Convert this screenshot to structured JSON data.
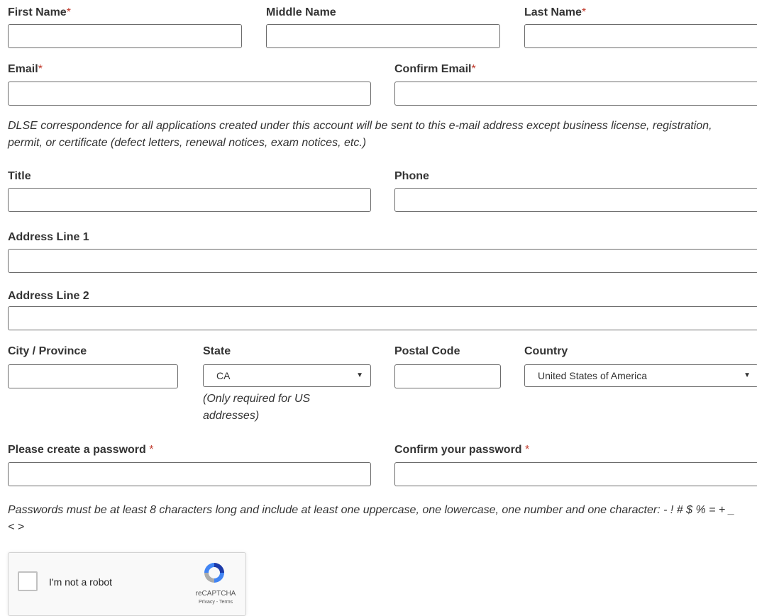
{
  "required_marker": "*",
  "fields": {
    "first_name": {
      "label": "First Name",
      "value": ""
    },
    "middle_name": {
      "label": "Middle Name",
      "value": ""
    },
    "last_name": {
      "label": "Last Name",
      "value": ""
    },
    "email": {
      "label": "Email",
      "value": ""
    },
    "confirm_email": {
      "label": "Confirm Email",
      "value": ""
    },
    "title": {
      "label": "Title",
      "value": ""
    },
    "phone": {
      "label": "Phone",
      "value": ""
    },
    "address1": {
      "label": "Address Line 1",
      "value": ""
    },
    "address2": {
      "label": "Address Line 2",
      "value": ""
    },
    "city": {
      "label": "City / Province",
      "value": ""
    },
    "state": {
      "label": "State",
      "selected": "CA",
      "note": "(Only required for US addresses)"
    },
    "postal_code": {
      "label": "Postal Code",
      "value": ""
    },
    "country": {
      "label": "Country",
      "selected": "United States of America"
    },
    "password": {
      "label": "Please create a password",
      "value": ""
    },
    "confirm_password": {
      "label": "Confirm your password",
      "value": ""
    }
  },
  "notes": {
    "email_note": "DLSE correspondence for all applications created under this account will be sent to this e-mail address except business license, registration, permit, or certificate (defect letters, renewal notices, exam notices, etc.)",
    "password_note": "Passwords must be at least 8 characters long and include at least one uppercase, one lowercase, one number and one character: - ! # $ % = + _ < >"
  },
  "captcha": {
    "label": "I'm not a robot",
    "brand": "reCAPTCHA",
    "links": "Privacy - Terms",
    "logo_icon": "recaptcha-logo-icon"
  },
  "colors": {
    "required": "#c0392b",
    "border": "#6b6b6b",
    "text": "#333333"
  }
}
